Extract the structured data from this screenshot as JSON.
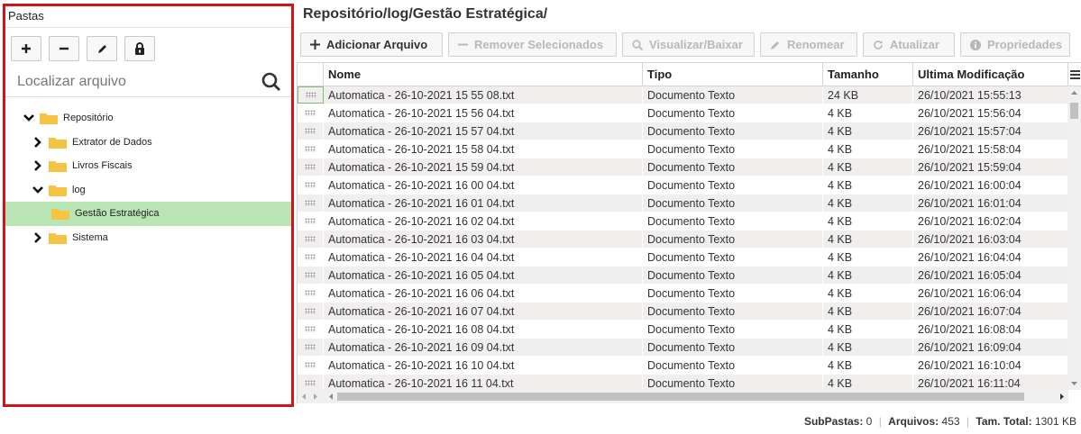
{
  "left_panel": {
    "title": "Pastas",
    "tool_icons": [
      "plus-icon",
      "minus-icon",
      "pencil-icon",
      "lock-icon"
    ],
    "search_placeholder": "Localizar arquivo",
    "tree": [
      {
        "label": "Repositório",
        "expanded": true,
        "level": 0
      },
      {
        "label": "Extrator de Dados",
        "expanded": false,
        "level": 1
      },
      {
        "label": "Livros Fiscais",
        "expanded": false,
        "level": 1
      },
      {
        "label": "log",
        "expanded": true,
        "level": 1
      },
      {
        "label": "Gestão Estratégica",
        "selected": true,
        "level": 2
      },
      {
        "label": "Sistema",
        "expanded": false,
        "level": 1
      }
    ]
  },
  "breadcrumb": "Repositório/log/Gestão Estratégica/",
  "toolbar": {
    "add": "Adicionar Arquivo",
    "remove": "Remover Selecionados",
    "view": "Visualizar/Baixar",
    "rename": "Renomear",
    "refresh": "Atualizar",
    "properties": "Propriedades"
  },
  "table": {
    "columns": [
      "Nome",
      "Tipo",
      "Tamanho",
      "Ultima Modificação"
    ],
    "rows": [
      [
        "Automatica - 26-10-2021 15 55 08.txt",
        "Documento Texto",
        "24 KB",
        "26/10/2021 15:55:13"
      ],
      [
        "Automatica - 26-10-2021 15 56 04.txt",
        "Documento Texto",
        "4 KB",
        "26/10/2021 15:56:04"
      ],
      [
        "Automatica - 26-10-2021 15 57 04.txt",
        "Documento Texto",
        "4 KB",
        "26/10/2021 15:57:04"
      ],
      [
        "Automatica - 26-10-2021 15 58 04.txt",
        "Documento Texto",
        "4 KB",
        "26/10/2021 15:58:04"
      ],
      [
        "Automatica - 26-10-2021 15 59 04.txt",
        "Documento Texto",
        "4 KB",
        "26/10/2021 15:59:04"
      ],
      [
        "Automatica - 26-10-2021 16 00 04.txt",
        "Documento Texto",
        "4 KB",
        "26/10/2021 16:00:04"
      ],
      [
        "Automatica - 26-10-2021 16 01 04.txt",
        "Documento Texto",
        "4 KB",
        "26/10/2021 16:01:04"
      ],
      [
        "Automatica - 26-10-2021 16 02 04.txt",
        "Documento Texto",
        "4 KB",
        "26/10/2021 16:02:04"
      ],
      [
        "Automatica - 26-10-2021 16 03 04.txt",
        "Documento Texto",
        "4 KB",
        "26/10/2021 16:03:04"
      ],
      [
        "Automatica - 26-10-2021 16 04 04.txt",
        "Documento Texto",
        "4 KB",
        "26/10/2021 16:04:04"
      ],
      [
        "Automatica - 26-10-2021 16 05 04.txt",
        "Documento Texto",
        "4 KB",
        "26/10/2021 16:05:04"
      ],
      [
        "Automatica - 26-10-2021 16 06 04.txt",
        "Documento Texto",
        "4 KB",
        "26/10/2021 16:06:04"
      ],
      [
        "Automatica - 26-10-2021 16 07 04.txt",
        "Documento Texto",
        "4 KB",
        "26/10/2021 16:07:04"
      ],
      [
        "Automatica - 26-10-2021 16 08 04.txt",
        "Documento Texto",
        "4 KB",
        "26/10/2021 16:08:04"
      ],
      [
        "Automatica - 26-10-2021 16 09 04.txt",
        "Documento Texto",
        "4 KB",
        "26/10/2021 16:09:04"
      ],
      [
        "Automatica - 26-10-2021 16 10 04.txt",
        "Documento Texto",
        "4 KB",
        "26/10/2021 16:10:04"
      ],
      [
        "Automatica - 26-10-2021 16 11 04.txt",
        "Documento Texto",
        "4 KB",
        "26/10/2021 16:11:04"
      ]
    ]
  },
  "status": {
    "subfolders_label": "SubPastas:",
    "subfolders": "0",
    "files_label": "Arquivos:",
    "files": "453",
    "total_label": "Tam. Total:",
    "total": "1301 KB"
  },
  "colors": {
    "highlight_border": "#d0141b",
    "selected_node": "#b9e6b4",
    "folder": "#f6c443"
  }
}
